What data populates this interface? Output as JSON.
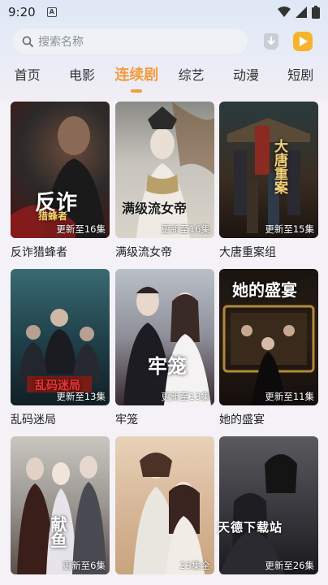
{
  "status": {
    "time": "9:20",
    "a_icon": "A"
  },
  "search": {
    "placeholder": "搜索名称"
  },
  "tabs": [
    {
      "label": "首页"
    },
    {
      "label": "电影"
    },
    {
      "label": "连续剧"
    },
    {
      "label": "综艺"
    },
    {
      "label": "动漫"
    },
    {
      "label": "短剧"
    }
  ],
  "active_tab": "连续剧",
  "shows": [
    {
      "title": "反诈猎蜂者",
      "badge": "更新至16集",
      "art": "反诈",
      "art2": "猎蜂者"
    },
    {
      "title": "满级流女帝",
      "badge": "更新至16集",
      "art": "满级流女帝",
      "art2": ""
    },
    {
      "title": "大唐重案组",
      "badge": "更新至15集",
      "art": "大唐重案",
      "art2": ""
    },
    {
      "title": "乱码迷局",
      "badge": "更新至13集",
      "art": "乱码迷局",
      "art2": ""
    },
    {
      "title": "牢笼",
      "badge": "更新至13集",
      "art": "牢笼",
      "art2": ""
    },
    {
      "title": "她的盛宴",
      "badge": "更新至11集",
      "art": "她的盛宴",
      "art2": ""
    },
    {
      "title": "",
      "badge": "更新至6集",
      "art": "献鱼",
      "art2": ""
    },
    {
      "title": "",
      "badge": "23集全",
      "art": "",
      "art2": ""
    },
    {
      "title": "",
      "badge": "更新至26集",
      "art": "",
      "art2": ""
    }
  ],
  "watermark": "天德下载站",
  "colors": {
    "accent": "#f59a3e",
    "play_icon": "#f7b32b"
  }
}
